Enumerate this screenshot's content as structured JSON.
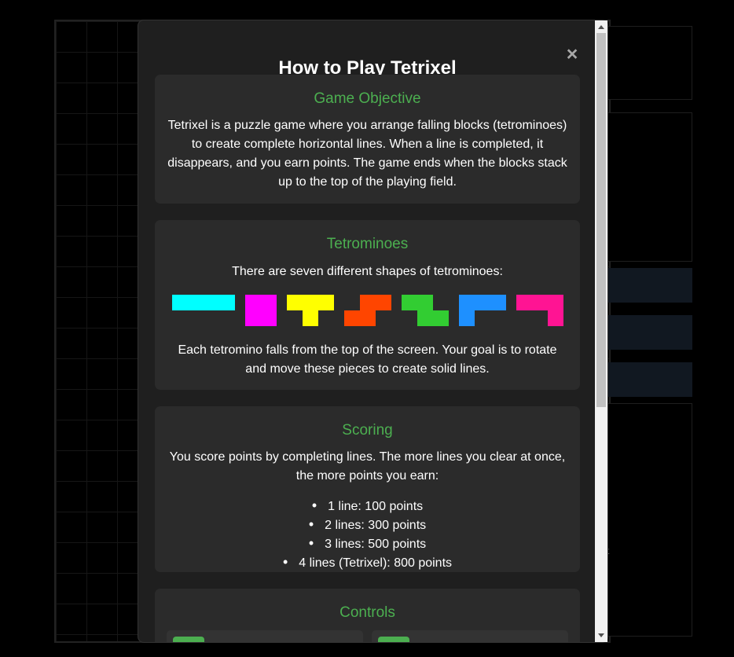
{
  "modal": {
    "title": "How to Play Tetrixel",
    "close_symbol": "×"
  },
  "sections": {
    "objective": {
      "heading": "Game Objective",
      "lines": [
        "Tetrixel is a puzzle game where you arrange falling blocks (tetrominoes)",
        "to create complete horizontal lines. When a line is completed, it",
        "disappears, and you earn points. The game ends when the blocks stack",
        "up to the top of the playing field."
      ]
    },
    "tetrominoes": {
      "heading": "Tetrominoes",
      "intro": "There are seven different shapes of tetrominoes:",
      "pieces": [
        {
          "name": "I",
          "color": "#00ffff"
        },
        {
          "name": "O",
          "color": "#ff00ff"
        },
        {
          "name": "T",
          "color": "#ffff00"
        },
        {
          "name": "S",
          "color": "#ff4500"
        },
        {
          "name": "Z",
          "color": "#32cd32"
        },
        {
          "name": "J",
          "color": "#1e90ff"
        },
        {
          "name": "L",
          "color": "#ff1493"
        }
      ],
      "lines": [
        "Each tetromino falls from the top of the screen. Your goal is to rotate",
        "and move these pieces to create solid lines."
      ]
    },
    "scoring": {
      "heading": "Scoring",
      "lines": [
        "You score points by completing lines. The more lines you clear at once,",
        "the more points you earn:"
      ],
      "items": [
        "1 line: 100 points",
        "2 lines: 300 points",
        "3 lines: 500 points",
        "4 lines (Tetrixel): 800 points"
      ]
    },
    "controls": {
      "heading": "Controls"
    }
  },
  "theme": {
    "accent": "#4caf50",
    "modal_bg": "#1f1f1f",
    "card_bg": "#2b2b2b"
  }
}
